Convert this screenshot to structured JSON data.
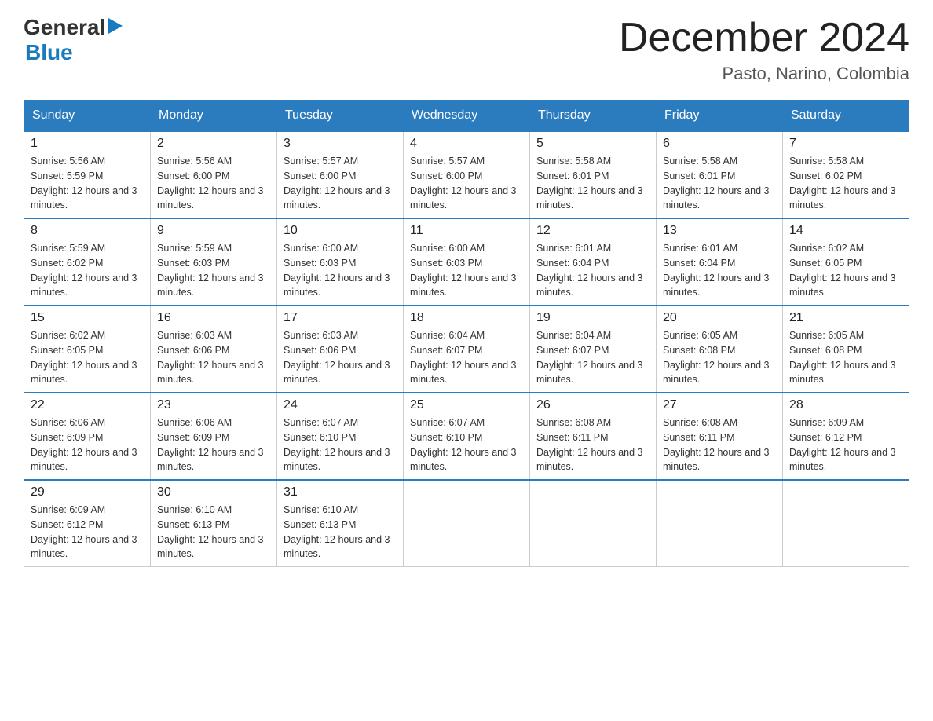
{
  "header": {
    "logo": {
      "general": "General",
      "arrow": "▶",
      "blue": "Blue"
    },
    "month": "December 2024",
    "location": "Pasto, Narino, Colombia"
  },
  "days_of_week": [
    "Sunday",
    "Monday",
    "Tuesday",
    "Wednesday",
    "Thursday",
    "Friday",
    "Saturday"
  ],
  "weeks": [
    [
      {
        "day": "1",
        "sunrise": "5:56 AM",
        "sunset": "5:59 PM",
        "daylight": "12 hours and 3 minutes."
      },
      {
        "day": "2",
        "sunrise": "5:56 AM",
        "sunset": "6:00 PM",
        "daylight": "12 hours and 3 minutes."
      },
      {
        "day": "3",
        "sunrise": "5:57 AM",
        "sunset": "6:00 PM",
        "daylight": "12 hours and 3 minutes."
      },
      {
        "day": "4",
        "sunrise": "5:57 AM",
        "sunset": "6:00 PM",
        "daylight": "12 hours and 3 minutes."
      },
      {
        "day": "5",
        "sunrise": "5:58 AM",
        "sunset": "6:01 PM",
        "daylight": "12 hours and 3 minutes."
      },
      {
        "day": "6",
        "sunrise": "5:58 AM",
        "sunset": "6:01 PM",
        "daylight": "12 hours and 3 minutes."
      },
      {
        "day": "7",
        "sunrise": "5:58 AM",
        "sunset": "6:02 PM",
        "daylight": "12 hours and 3 minutes."
      }
    ],
    [
      {
        "day": "8",
        "sunrise": "5:59 AM",
        "sunset": "6:02 PM",
        "daylight": "12 hours and 3 minutes."
      },
      {
        "day": "9",
        "sunrise": "5:59 AM",
        "sunset": "6:03 PM",
        "daylight": "12 hours and 3 minutes."
      },
      {
        "day": "10",
        "sunrise": "6:00 AM",
        "sunset": "6:03 PM",
        "daylight": "12 hours and 3 minutes."
      },
      {
        "day": "11",
        "sunrise": "6:00 AM",
        "sunset": "6:03 PM",
        "daylight": "12 hours and 3 minutes."
      },
      {
        "day": "12",
        "sunrise": "6:01 AM",
        "sunset": "6:04 PM",
        "daylight": "12 hours and 3 minutes."
      },
      {
        "day": "13",
        "sunrise": "6:01 AM",
        "sunset": "6:04 PM",
        "daylight": "12 hours and 3 minutes."
      },
      {
        "day": "14",
        "sunrise": "6:02 AM",
        "sunset": "6:05 PM",
        "daylight": "12 hours and 3 minutes."
      }
    ],
    [
      {
        "day": "15",
        "sunrise": "6:02 AM",
        "sunset": "6:05 PM",
        "daylight": "12 hours and 3 minutes."
      },
      {
        "day": "16",
        "sunrise": "6:03 AM",
        "sunset": "6:06 PM",
        "daylight": "12 hours and 3 minutes."
      },
      {
        "day": "17",
        "sunrise": "6:03 AM",
        "sunset": "6:06 PM",
        "daylight": "12 hours and 3 minutes."
      },
      {
        "day": "18",
        "sunrise": "6:04 AM",
        "sunset": "6:07 PM",
        "daylight": "12 hours and 3 minutes."
      },
      {
        "day": "19",
        "sunrise": "6:04 AM",
        "sunset": "6:07 PM",
        "daylight": "12 hours and 3 minutes."
      },
      {
        "day": "20",
        "sunrise": "6:05 AM",
        "sunset": "6:08 PM",
        "daylight": "12 hours and 3 minutes."
      },
      {
        "day": "21",
        "sunrise": "6:05 AM",
        "sunset": "6:08 PM",
        "daylight": "12 hours and 3 minutes."
      }
    ],
    [
      {
        "day": "22",
        "sunrise": "6:06 AM",
        "sunset": "6:09 PM",
        "daylight": "12 hours and 3 minutes."
      },
      {
        "day": "23",
        "sunrise": "6:06 AM",
        "sunset": "6:09 PM",
        "daylight": "12 hours and 3 minutes."
      },
      {
        "day": "24",
        "sunrise": "6:07 AM",
        "sunset": "6:10 PM",
        "daylight": "12 hours and 3 minutes."
      },
      {
        "day": "25",
        "sunrise": "6:07 AM",
        "sunset": "6:10 PM",
        "daylight": "12 hours and 3 minutes."
      },
      {
        "day": "26",
        "sunrise": "6:08 AM",
        "sunset": "6:11 PM",
        "daylight": "12 hours and 3 minutes."
      },
      {
        "day": "27",
        "sunrise": "6:08 AM",
        "sunset": "6:11 PM",
        "daylight": "12 hours and 3 minutes."
      },
      {
        "day": "28",
        "sunrise": "6:09 AM",
        "sunset": "6:12 PM",
        "daylight": "12 hours and 3 minutes."
      }
    ],
    [
      {
        "day": "29",
        "sunrise": "6:09 AM",
        "sunset": "6:12 PM",
        "daylight": "12 hours and 3 minutes."
      },
      {
        "day": "30",
        "sunrise": "6:10 AM",
        "sunset": "6:13 PM",
        "daylight": "12 hours and 3 minutes."
      },
      {
        "day": "31",
        "sunrise": "6:10 AM",
        "sunset": "6:13 PM",
        "daylight": "12 hours and 3 minutes."
      },
      null,
      null,
      null,
      null
    ]
  ],
  "labels": {
    "sunrise": "Sunrise:",
    "sunset": "Sunset:",
    "daylight": "Daylight:"
  }
}
